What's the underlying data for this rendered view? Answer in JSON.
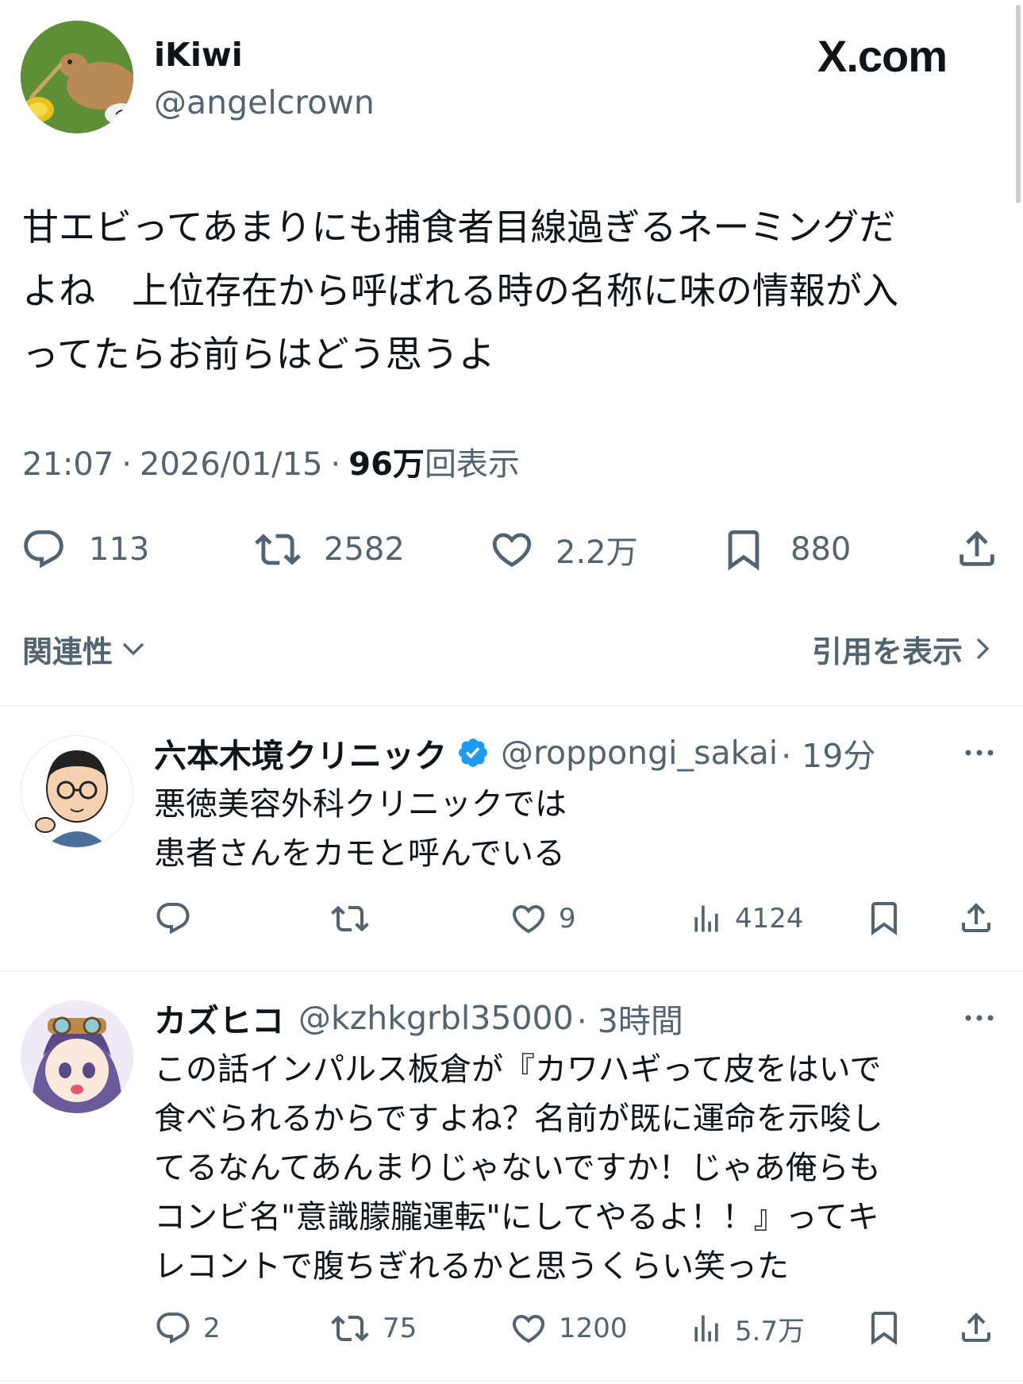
{
  "brand": {
    "label": "X.com"
  },
  "main_tweet": {
    "display_name": "iKiwi",
    "handle": "@angelcrown",
    "text_lines": [
      "甘エビってあまりにも捕食者目線過ぎるネーミングだ",
      "よね　上位存在から呼ばれる時の名称に味の情報が入",
      "ってたらお前らはどう思うよ"
    ],
    "meta": {
      "time": "21:07",
      "sep1": "·",
      "date": "2026/01/15",
      "sep2": "·",
      "views_value": "96万",
      "views_label": "回表示"
    },
    "actions": {
      "reply": "113",
      "retweet": "2582",
      "like": "2.2万",
      "bookmark": "880"
    }
  },
  "filters": {
    "sort_label": "関連性",
    "quotes_label": "引用を表示"
  },
  "replies": [
    {
      "display_name": "六本木境クリニック",
      "verified": true,
      "handle": "@roppongi_sakai",
      "age": "· 19分",
      "text_lines": [
        "悪徳美容外科クリニックでは",
        "患者さんをカモと呼んでいる"
      ],
      "actions": {
        "reply": "",
        "retweet": "",
        "like": "9",
        "views": "4124"
      }
    },
    {
      "display_name": "カズヒコ",
      "verified": false,
      "handle": "@kzhkgrbl35000",
      "age": "· 3時間",
      "text_lines": [
        "この話インパルス板倉が『カワハギって皮をはいで",
        "食べられるからですよね？名前が既に運命を示唆し",
        "てるなんてあんまりじゃないですか！じゃあ俺らも",
        "コンビ名\"意識朦朧運転\"にしてやるよ！！』ってキ",
        "レコントで腹ちぎれるかと思うくらい笑った"
      ],
      "actions": {
        "reply": "2",
        "retweet": "75",
        "like": "1200",
        "views": "5.7万"
      }
    }
  ],
  "colors": {
    "text": "#0f1419",
    "muted": "#536471",
    "verified": "#1d9bf0",
    "divider": "#eff3f4"
  },
  "icons": [
    "reply-icon",
    "retweet-icon",
    "like-icon",
    "bookmark-icon",
    "share-icon",
    "views-icon",
    "more-icon",
    "chevron-down-icon",
    "chevron-right-icon",
    "verified-icon"
  ]
}
